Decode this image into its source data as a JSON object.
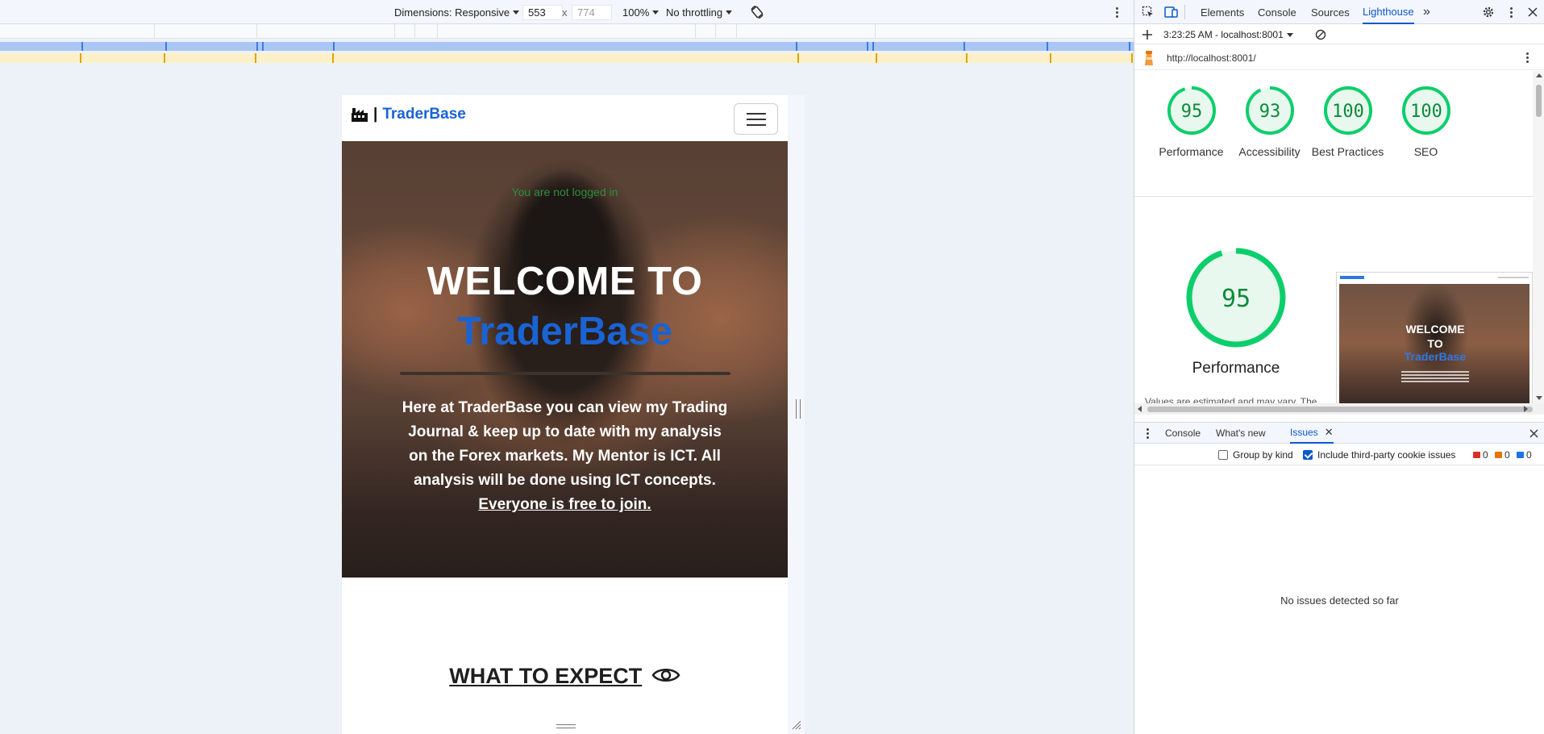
{
  "device_toolbar": {
    "dimensions_label": "Dimensions: Responsive",
    "width_value": "553",
    "times": "x",
    "height_value": "774",
    "zoom": "100%",
    "throttling": "No throttling"
  },
  "page": {
    "brand_separator": "|",
    "brand_name": "TraderBase",
    "login_status": "You are not logged in",
    "welcome_line": "WELCOME TO",
    "welcome_name": "TraderBase",
    "hero_text": "Here at TraderBase you can view my Trading Journal & keep up to date with my analysis on the Forex markets. My Mentor is ICT. All analysis will be done using ICT concepts.",
    "hero_link": "Everyone is free to join.",
    "section_heading": "WHAT TO EXPECT"
  },
  "devtools": {
    "tabs": [
      "Elements",
      "Console",
      "Sources",
      "Lighthouse"
    ],
    "active_tab": "Lighthouse",
    "report_selector": "3:23:25 AM - localhost:8001",
    "url": "http://localhost:8001/",
    "scores": [
      {
        "label": "Performance",
        "value": 95
      },
      {
        "label": "Accessibility",
        "value": 93
      },
      {
        "label": "Best Practices",
        "value": 100
      },
      {
        "label": "SEO",
        "value": 100
      }
    ],
    "big_score": {
      "label": "Performance",
      "value": 95
    },
    "perf_note": "Values are estimated and may vary. The",
    "thumbnail": {
      "line1": "WELCOME",
      "line2": "TO",
      "line3": "TraderBase"
    },
    "drawer_tabs": [
      "Console",
      "What's new",
      "Issues"
    ],
    "active_drawer_tab": "Issues",
    "group_by_kind": "Group by kind",
    "include_third_party": "Include third-party cookie issues",
    "issue_counts": {
      "errors": "0",
      "warnings": "0",
      "info": "0"
    },
    "no_issues": "No issues detected so far"
  },
  "colors": {
    "brand_blue": "#1a63d3",
    "score_green": "#0cce6b",
    "devtools_active": "#0b57d0"
  }
}
